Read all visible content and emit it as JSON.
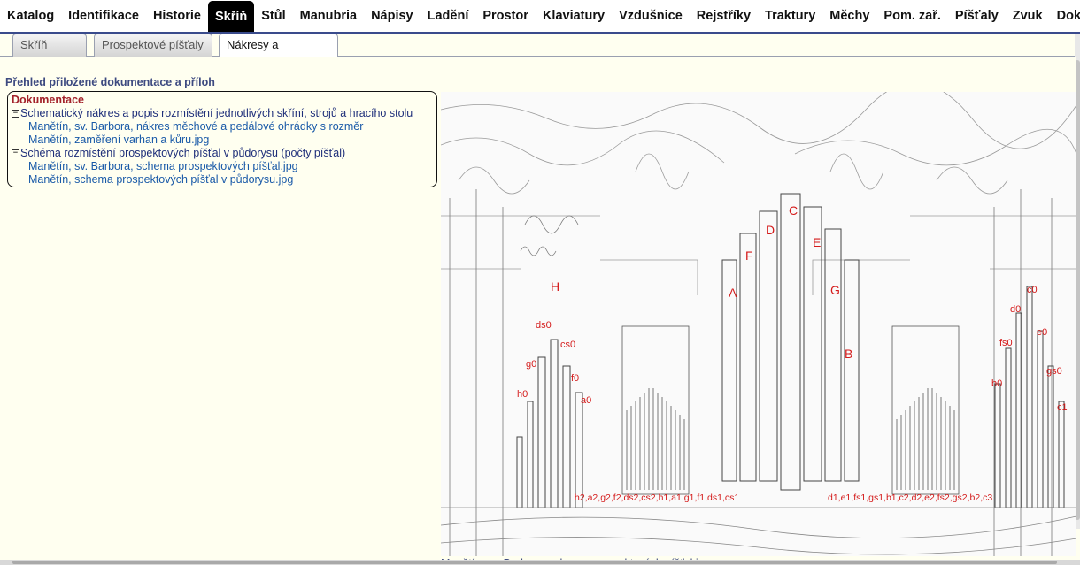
{
  "nav": {
    "items": [
      {
        "label": "Katalog"
      },
      {
        "label": "Identifikace"
      },
      {
        "label": "Historie"
      },
      {
        "label": "Skříň",
        "active": true
      },
      {
        "label": "Stůl"
      },
      {
        "label": "Manubria"
      },
      {
        "label": "Nápisy"
      },
      {
        "label": "Ladění"
      },
      {
        "label": "Prostor"
      },
      {
        "label": "Klaviatury"
      },
      {
        "label": "Vzdušnice"
      },
      {
        "label": "Rejstříky"
      },
      {
        "label": "Traktury"
      },
      {
        "label": "Měchy"
      },
      {
        "label": "Pom. zař."
      },
      {
        "label": "Píšťaly"
      },
      {
        "label": "Zvuk"
      },
      {
        "label": "Dokume"
      }
    ]
  },
  "subtabs": {
    "items": [
      {
        "label": "Skříň"
      },
      {
        "label": "Prospektové píšťaly"
      },
      {
        "label": "Nákresy a schémata",
        "active": true
      }
    ]
  },
  "section_title": "Přehled přiložené dokumentace a příloh",
  "docs": {
    "heading": "Dokumentace",
    "group1_label": "Schematický nákres a popis rozmístění jednotlivých skříní, strojů a hracího stolu",
    "group1_link1": "Manětín, sv. Barbora, nákres měchové a pedálové ohrádky s rozměr",
    "group1_link2": "Manětín, zaměření varhan a kůru.jpg",
    "group2_label": "Schéma rozmístění prospektových píšťal v půdorysu (počty píšťal)",
    "group2_link1": "Manětín, sv. Barbora, schema prospektových píšťal.jpg",
    "group2_link2": "Manětín, schema prospektových píšťal v půdorysu.jpg",
    "toggle_symbol": "−"
  },
  "preview": {
    "caption": "Manětín, sv. Barbora, schema prospektových píšťal.jpg",
    "labels": {
      "A": "A",
      "B": "B",
      "C": "C",
      "D": "D",
      "E": "E",
      "F": "F",
      "G": "G",
      "H": "H",
      "ds0": "ds0",
      "cs0": "cs0",
      "g0": "g0",
      "f0": "f0",
      "h0": "h0",
      "a0": "a0",
      "c0": "c0",
      "d0": "d0",
      "e0": "e0",
      "fs0": "fs0",
      "gs0": "gs0",
      "b0": "b0",
      "c1": "c1",
      "left_series": "h2,a2,g2,f2,ds2,cs2,h1,a1,g1,f1,ds1,cs1",
      "right_series": "d1,e1,fs1,gs1,b1,c2,d2,e2,fs2,gs2,b2,c3"
    }
  },
  "colors": {
    "nav_border": "#3a4b8c",
    "label_red": "#d41a1a",
    "heading_red": "#a3212a",
    "link_blue": "#1a5aa8"
  }
}
